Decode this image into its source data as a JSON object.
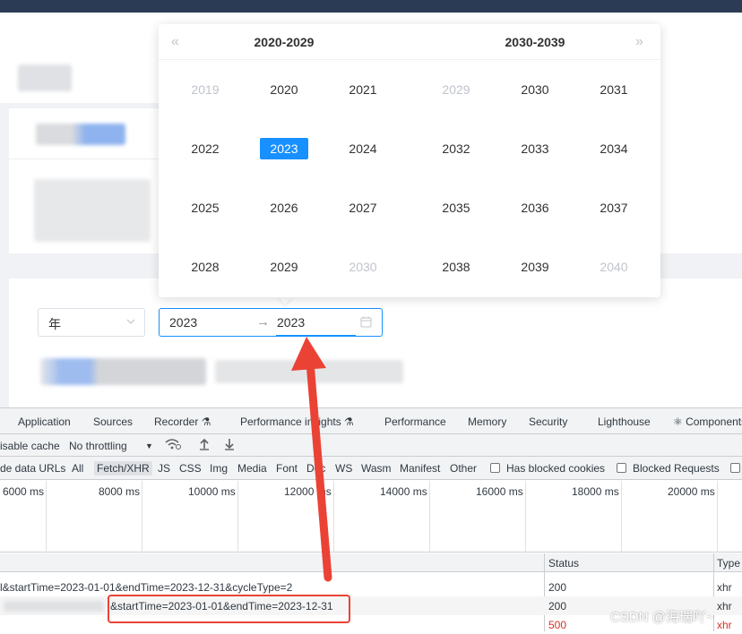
{
  "picker": {
    "left_header": "2020-2029",
    "right_header": "2030-2039",
    "prev_label": "«",
    "next_label": "»",
    "left_years": [
      "2019",
      "2020",
      "2021",
      "2022",
      "2023",
      "2024",
      "2025",
      "2026",
      "2027",
      "2028",
      "2029",
      "2030"
    ],
    "right_years": [
      "2029",
      "2030",
      "2031",
      "2032",
      "2033",
      "2034",
      "2035",
      "2036",
      "2037",
      "2038",
      "2039",
      "2040"
    ],
    "selected_year": "2023"
  },
  "form": {
    "period_select": "年",
    "range_start": "2023",
    "range_separator": "→",
    "range_end": "2023"
  },
  "devtools": {
    "tabs": [
      "Application",
      "Sources",
      "Recorder ⚗",
      "Performance insights ⚗",
      "Performance",
      "Memory",
      "Security",
      "Lighthouse",
      "⚛ Components"
    ],
    "toolbar": {
      "cache_label": "isable cache",
      "throttle_label": "No throttling"
    },
    "filters": [
      "de data URLs",
      "All",
      "Fetch/XHR",
      "JS",
      "CSS",
      "Img",
      "Media",
      "Font",
      "Doc",
      "WS",
      "Wasm",
      "Manifest",
      "Other"
    ],
    "checks": [
      "Has blocked cookies",
      "Blocked Requests"
    ],
    "timeline": [
      "6000 ms",
      "8000 ms",
      "10000 ms",
      "12000 ms",
      "14000 ms",
      "16000 ms",
      "18000 ms",
      "20000 ms"
    ],
    "columns": {
      "status": "Status",
      "type": "Type"
    },
    "rows": [
      {
        "name": "l&startTime=2023-01-01&endTime=2023-12-31&cycleType=2",
        "status": "200",
        "type": "xhr"
      },
      {
        "name": "&startTime=2023-01-01&endTime=2023-12-31",
        "status": "200",
        "type": "xhr"
      },
      {
        "name": "",
        "status": "500",
        "type": "xhr"
      }
    ]
  },
  "watermark": "CSDN @海瑞吖~",
  "colors": {
    "accent": "#1890ff",
    "annotation_red": "#ea4335",
    "topbar": "#2b3a55"
  }
}
